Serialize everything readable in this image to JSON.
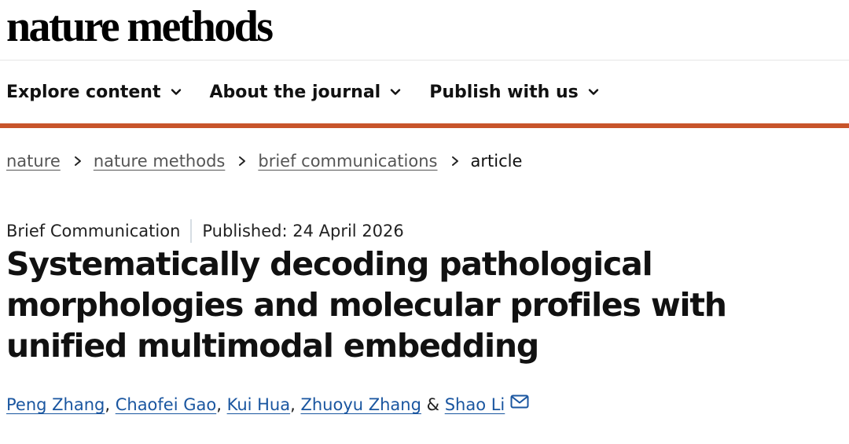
{
  "header": {
    "logo_text": "nature methods"
  },
  "nav": {
    "items": [
      {
        "label": "Explore content",
        "icon": "chevron-down-icon"
      },
      {
        "label": "About the journal",
        "icon": "chevron-down-icon"
      },
      {
        "label": "Publish with us",
        "icon": "chevron-down-icon"
      }
    ],
    "accent_color": "#c8542a"
  },
  "breadcrumb": {
    "items": [
      {
        "label": "nature"
      },
      {
        "label": "nature methods"
      },
      {
        "label": "brief communications"
      },
      {
        "label": "article"
      }
    ],
    "separator_icon": "chevron-right-icon"
  },
  "article": {
    "type": "Brief Communication",
    "published": "Published: 24 April 2026",
    "title": "Systematically decoding pathological morphologies and molecular profiles with unified multimodal embedding",
    "authors": [
      {
        "name": "Peng Zhang"
      },
      {
        "name": "Chaofei Gao"
      },
      {
        "name": "Kui Hua"
      },
      {
        "name": "Zhuoyu Zhang"
      },
      {
        "name": "Shao Li"
      }
    ],
    "separators": {
      "comma": ", ",
      "and": " & "
    },
    "contact_icon": "mail-icon",
    "link_color": "#1a56a0"
  }
}
